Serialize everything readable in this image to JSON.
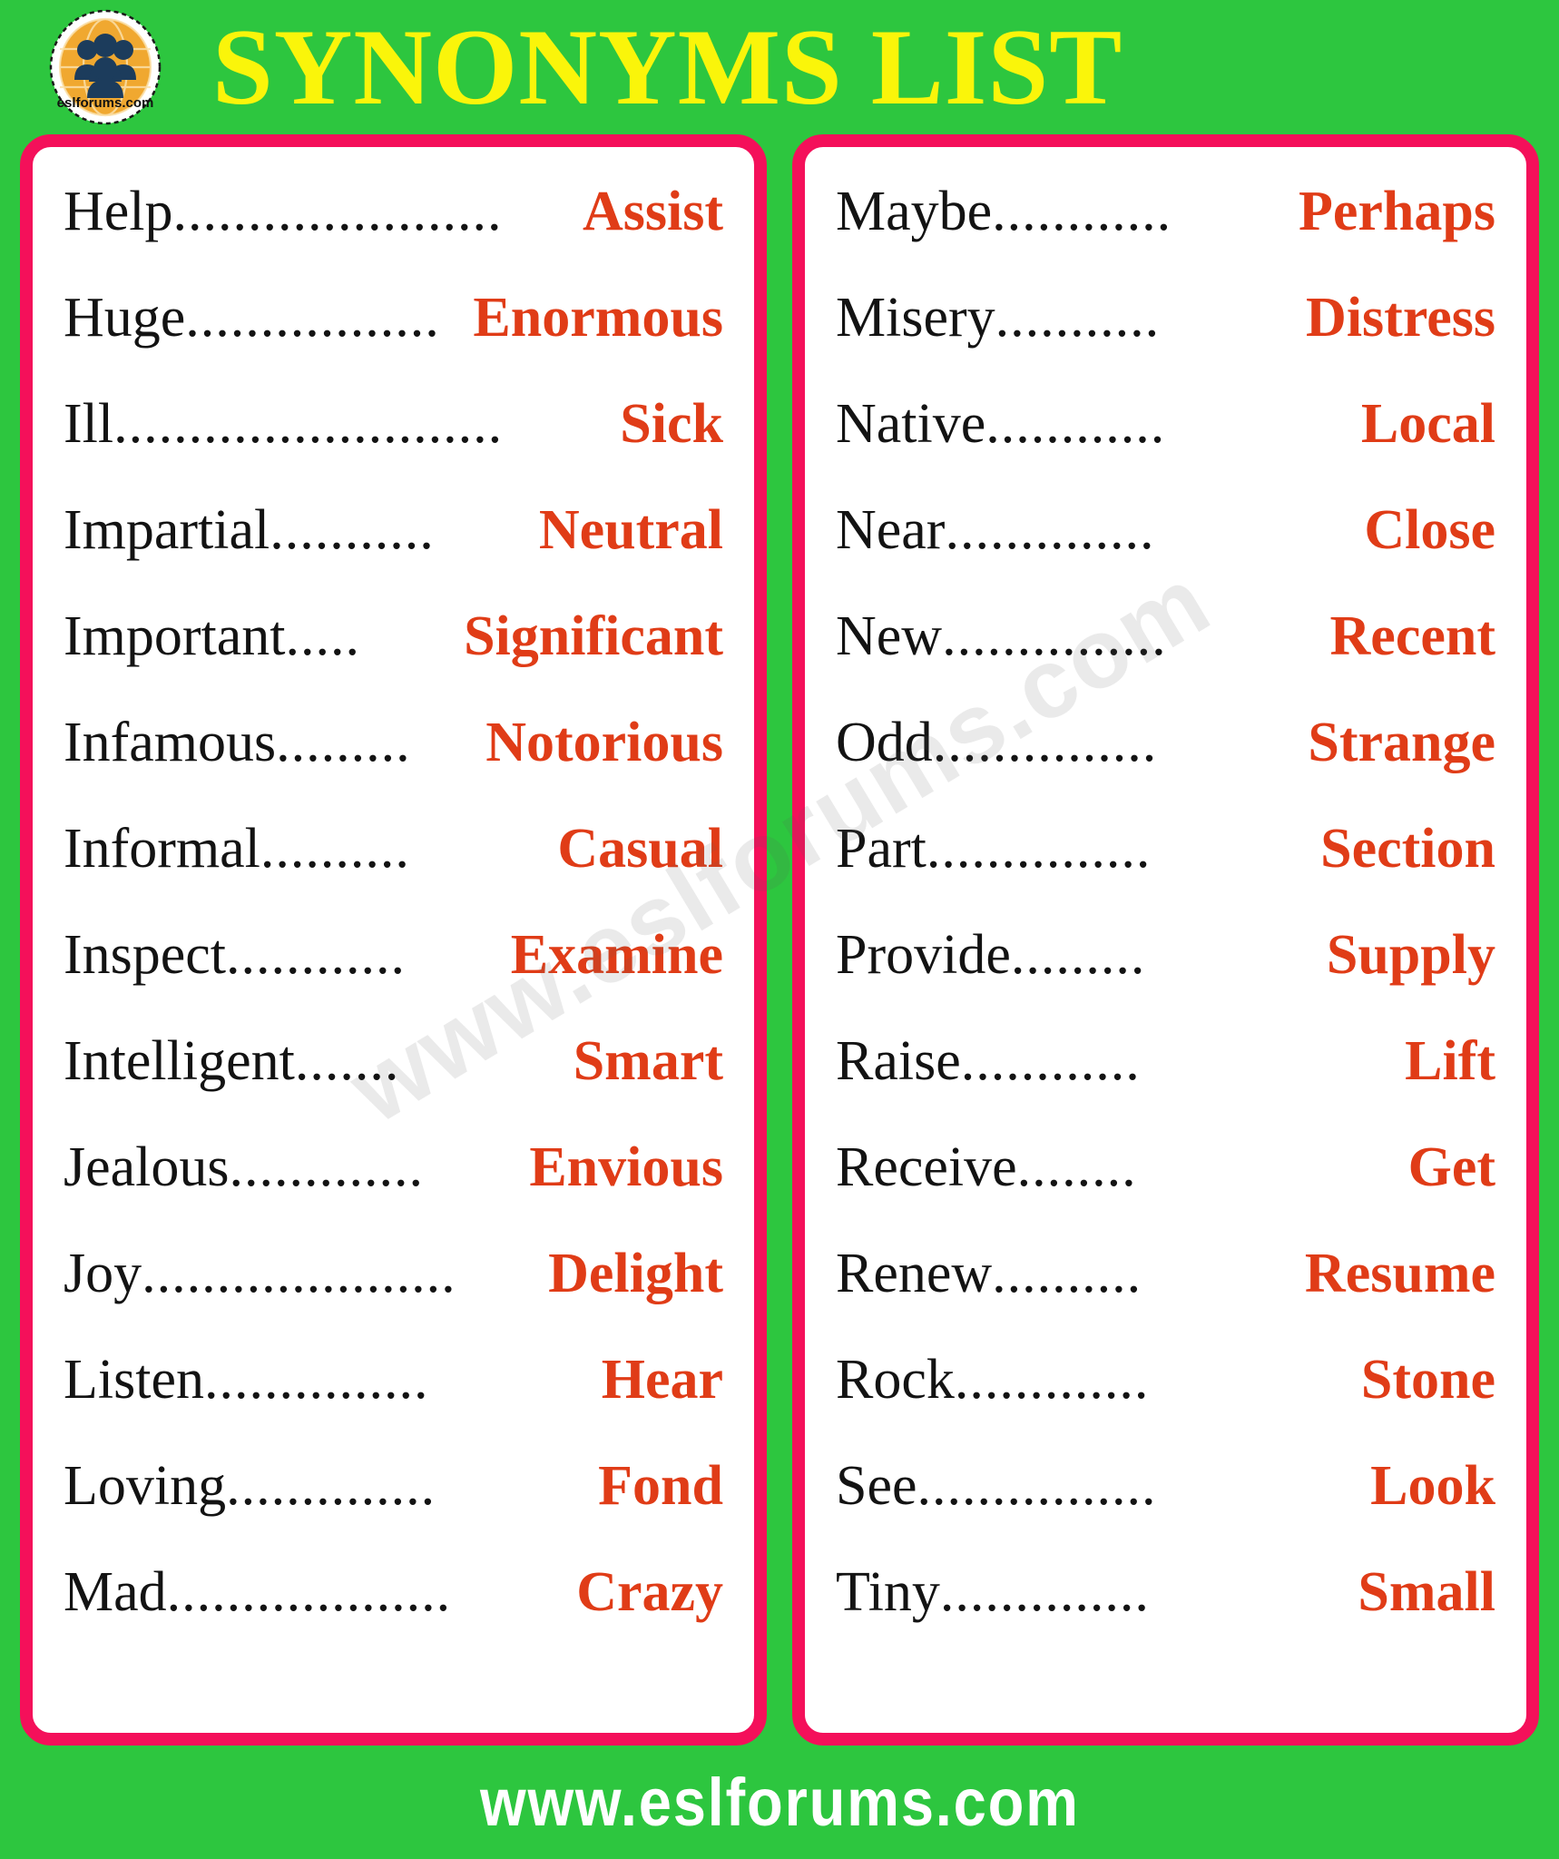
{
  "header": {
    "title": "SYNONYMS LIST",
    "logo_text": "eslforums.com",
    "logo_icon": "people-globe-logo"
  },
  "colors": {
    "background_green": "#2DC63F",
    "card_border_pink": "#F4105A",
    "title_yellow": "#FAF50A",
    "synonym_orange": "#E03C17",
    "word_black": "#131313",
    "card_white": "#FFFFFF",
    "logo_amber": "#F0A830",
    "logo_navy": "#1C3C5C"
  },
  "watermark": "www.eslforums.com",
  "footer": {
    "url": "www.eslforums.com"
  },
  "columns": [
    {
      "id": "left",
      "rows": [
        {
          "word": "Help",
          "leader": "......................",
          "synonym": "Assist"
        },
        {
          "word": "Huge",
          "leader": ".................",
          "synonym": "Enormous"
        },
        {
          "word": "Ill",
          "leader": "..........................",
          "synonym": "Sick"
        },
        {
          "word": "Impartial",
          "leader": "...........",
          "synonym": "Neutral"
        },
        {
          "word": "Important",
          "leader": ".....",
          "synonym": "Significant"
        },
        {
          "word": "Infamous",
          "leader": ".........",
          "synonym": "Notorious"
        },
        {
          "word": "Informal",
          "leader": "..........",
          "synonym": "Casual"
        },
        {
          "word": "Inspect",
          "leader": "............",
          "synonym": "Examine"
        },
        {
          "word": "Intelligent",
          "leader": ".......",
          "synonym": "Smart"
        },
        {
          "word": "Jealous",
          "leader": ".............",
          "synonym": "Envious"
        },
        {
          "word": "Joy",
          "leader": ".....................",
          "synonym": "Delight"
        },
        {
          "word": "Listen",
          "leader": "...............",
          "synonym": "Hear"
        },
        {
          "word": "Loving",
          "leader": "..............",
          "synonym": "Fond"
        },
        {
          "word": "Mad",
          "leader": "...................",
          "synonym": "Crazy"
        }
      ]
    },
    {
      "id": "right",
      "rows": [
        {
          "word": "Maybe",
          "leader": "............",
          "synonym": "Perhaps"
        },
        {
          "word": "Misery",
          "leader": "...........",
          "synonym": "Distress"
        },
        {
          "word": "Native",
          "leader": "............",
          "synonym": "Local"
        },
        {
          "word": "Near",
          "leader": "..............",
          "synonym": "Close"
        },
        {
          "word": "New",
          "leader": "...............",
          "synonym": "Recent"
        },
        {
          "word": "Odd",
          "leader": "...............",
          "synonym": "Strange"
        },
        {
          "word": "Part",
          "leader": "...............",
          "synonym": "Section"
        },
        {
          "word": "Provide",
          "leader": ".........",
          "synonym": "Supply"
        },
        {
          "word": "Raise",
          "leader": "............",
          "synonym": "Lift"
        },
        {
          "word": "Receive",
          "leader": "........",
          "synonym": "Get"
        },
        {
          "word": "Renew",
          "leader": "..........",
          "synonym": "Resume"
        },
        {
          "word": "Rock",
          "leader": ".............",
          "synonym": "Stone"
        },
        {
          "word": "See",
          "leader": "................",
          "synonym": "Look"
        },
        {
          "word": "Tiny",
          "leader": "..............",
          "synonym": "Small"
        }
      ]
    }
  ]
}
